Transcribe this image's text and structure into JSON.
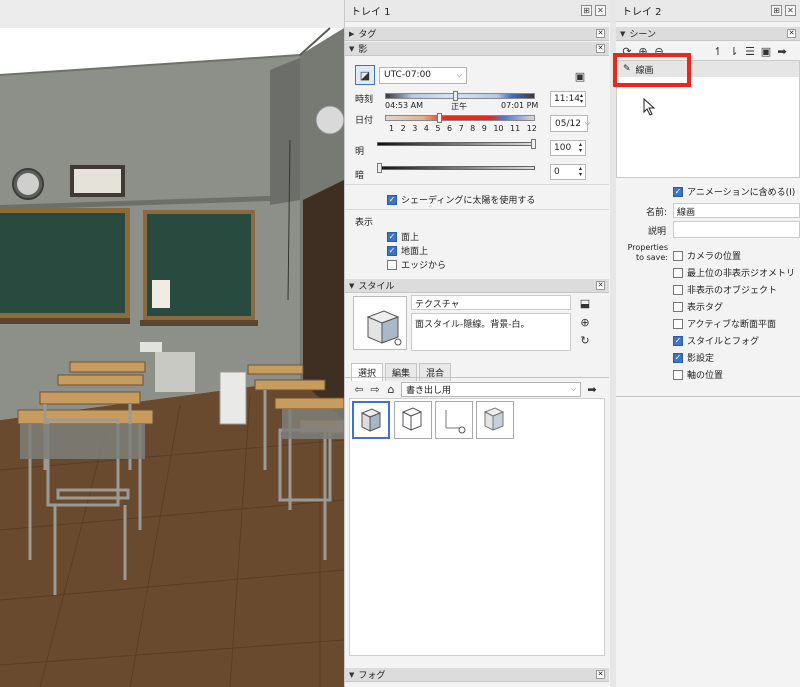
{
  "tray1": {
    "title": "トレイ 1",
    "tags_section": "タグ",
    "shadow_section": "影",
    "timezone": "UTC-07:00",
    "time_label": "時刻",
    "sunrise": "04:53 AM",
    "noon": "正午",
    "sunset": "07:01 PM",
    "time_value": "11:14",
    "date_label": "日付",
    "month_ticks": [
      "1",
      "2",
      "3",
      "4",
      "5",
      "6",
      "7",
      "8",
      "9",
      "10",
      "11",
      "12"
    ],
    "date_value": "05/12",
    "light_label": "明",
    "light_value": "100",
    "dark_label": "暗",
    "dark_value": "0",
    "use_sun_label": "シェーディングに太陽を使用する",
    "display_label": "表示",
    "display_options": [
      {
        "label": "面上",
        "checked": true
      },
      {
        "label": "地面上",
        "checked": true
      },
      {
        "label": "エッジから",
        "checked": false
      }
    ],
    "style_section": "スタイル",
    "style_name": "テクスチャ",
    "style_description": "面スタイル-隠線。背景-白。",
    "tabs": [
      "選択",
      "編集",
      "混合"
    ],
    "collection": "書き出し用",
    "fog_section": "フォグ"
  },
  "tray2": {
    "title": "トレイ 2",
    "scenes_section": "シーン",
    "scene_items": [
      "線画"
    ],
    "include_animation": "アニメーションに含める(I)",
    "name_label": "名前:",
    "name_value": "線画",
    "desc_label": "説明",
    "desc_value": "",
    "properties_label_1": "Properties",
    "properties_label_2": "to save:",
    "properties": [
      {
        "label": "カメラの位置",
        "checked": false
      },
      {
        "label": "最上位の非表示ジオメトリ",
        "checked": false
      },
      {
        "label": "非表示のオブジェクト",
        "checked": false
      },
      {
        "label": "表示タグ",
        "checked": false
      },
      {
        "label": "アクティブな断面平面",
        "checked": false
      },
      {
        "label": "スタイルとフォグ",
        "checked": true
      },
      {
        "label": "影設定",
        "checked": true
      },
      {
        "label": "軸の位置",
        "checked": false
      }
    ]
  },
  "colors": {
    "accent": "#3e74c8",
    "highlight": "#e8281c"
  }
}
